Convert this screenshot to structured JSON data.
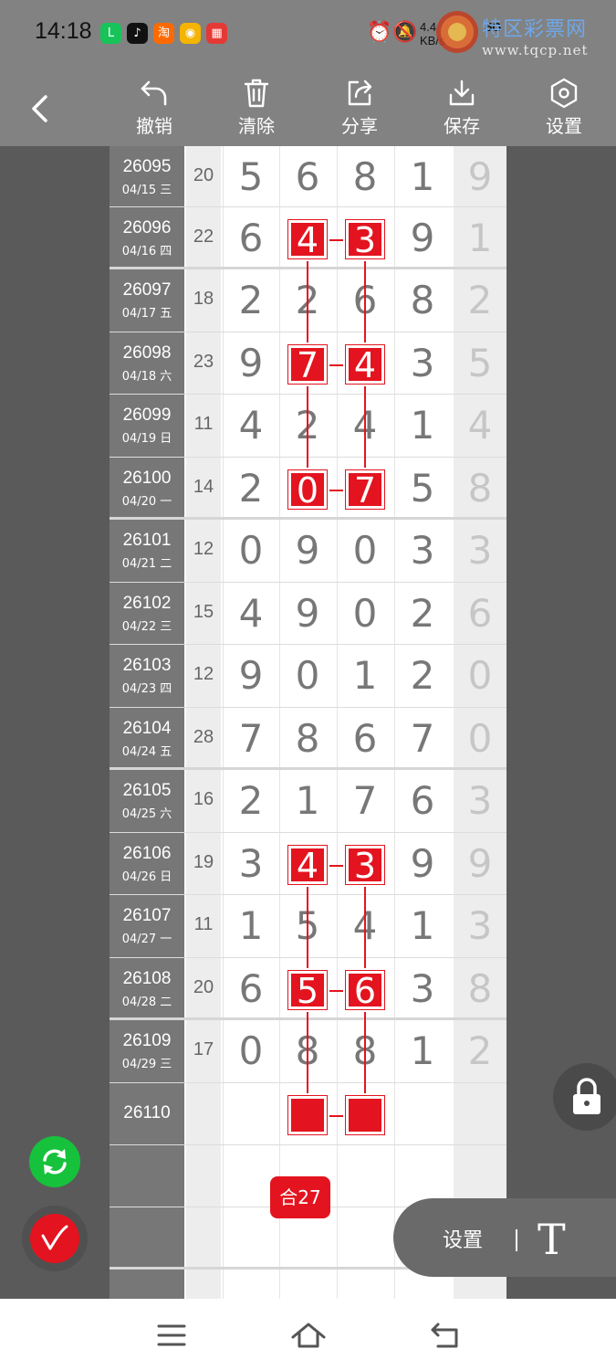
{
  "status_bar": {
    "time": "14:18",
    "apps": [
      {
        "icon": "wechat-icon",
        "glyph": "L",
        "color": "#18c35a"
      },
      {
        "icon": "tiktok-icon",
        "glyph": "♪",
        "color": "#111111"
      },
      {
        "icon": "taobao-icon",
        "glyph": "淘",
        "color": "#ff6a00"
      },
      {
        "icon": "app-yellow-icon",
        "glyph": "◉",
        "color": "#f4b400"
      },
      {
        "icon": "calendar-icon",
        "glyph": "▦",
        "color": "#e53935"
      }
    ],
    "speed": "4.4",
    "speed_unit": "KB/s",
    "network": "5G"
  },
  "watermark": {
    "title": "特区彩票网",
    "url": "www.tqcp.net"
  },
  "toolbar": {
    "undo_label": "撤销",
    "clear_label": "清除",
    "share_label": "分享",
    "save_label": "保存",
    "settings_label": "设置"
  },
  "table": {
    "rows": [
      {
        "id": "26095",
        "date": "04/15 三",
        "sum": "20",
        "digits": [
          "5",
          "6",
          "8",
          "1"
        ],
        "last": "9"
      },
      {
        "id": "26096",
        "date": "04/16 四",
        "sum": "22",
        "digits": [
          "6",
          "4",
          "3",
          "9"
        ],
        "last": "1"
      },
      {
        "id": "26097",
        "date": "04/17 五",
        "sum": "18",
        "digits": [
          "2",
          "2",
          "6",
          "8"
        ],
        "last": "2"
      },
      {
        "id": "26098",
        "date": "04/18 六",
        "sum": "23",
        "digits": [
          "9",
          "7",
          "4",
          "3"
        ],
        "last": "5"
      },
      {
        "id": "26099",
        "date": "04/19 日",
        "sum": "11",
        "digits": [
          "4",
          "2",
          "4",
          "1"
        ],
        "last": "4"
      },
      {
        "id": "26100",
        "date": "04/20 一",
        "sum": "14",
        "digits": [
          "2",
          "0",
          "7",
          "5"
        ],
        "last": "8"
      },
      {
        "id": "26101",
        "date": "04/21 二",
        "sum": "12",
        "digits": [
          "0",
          "9",
          "0",
          "3"
        ],
        "last": "3"
      },
      {
        "id": "26102",
        "date": "04/22 三",
        "sum": "15",
        "digits": [
          "4",
          "9",
          "0",
          "2"
        ],
        "last": "6"
      },
      {
        "id": "26103",
        "date": "04/23 四",
        "sum": "12",
        "digits": [
          "9",
          "0",
          "1",
          "2"
        ],
        "last": "0"
      },
      {
        "id": "26104",
        "date": "04/24 五",
        "sum": "28",
        "digits": [
          "7",
          "8",
          "6",
          "7"
        ],
        "last": "0"
      },
      {
        "id": "26105",
        "date": "04/25 六",
        "sum": "16",
        "digits": [
          "2",
          "1",
          "7",
          "6"
        ],
        "last": "3"
      },
      {
        "id": "26106",
        "date": "04/26 日",
        "sum": "19",
        "digits": [
          "3",
          "4",
          "3",
          "9"
        ],
        "last": "9"
      },
      {
        "id": "26107",
        "date": "04/27 一",
        "sum": "11",
        "digits": [
          "1",
          "5",
          "4",
          "1"
        ],
        "last": "3"
      },
      {
        "id": "26108",
        "date": "04/28 二",
        "sum": "20",
        "digits": [
          "6",
          "5",
          "6",
          "3"
        ],
        "last": "8"
      },
      {
        "id": "26109",
        "date": "04/29 三",
        "sum": "17",
        "digits": [
          "0",
          "8",
          "8",
          "1"
        ],
        "last": "2"
      },
      {
        "id": "26110",
        "date": "",
        "sum": "",
        "digits": [
          "",
          "",
          "",
          ""
        ],
        "last": ""
      },
      {
        "id": "",
        "date": "",
        "sum": "",
        "digits": [
          "",
          "",
          "",
          ""
        ],
        "last": ""
      },
      {
        "id": "",
        "date": "",
        "sum": "",
        "digits": [
          "",
          "",
          "",
          ""
        ],
        "last": ""
      }
    ],
    "marks": [
      {
        "row": 1,
        "col": 1,
        "value": "4"
      },
      {
        "row": 1,
        "col": 2,
        "value": "3"
      },
      {
        "row": 3,
        "col": 1,
        "value": "7"
      },
      {
        "row": 3,
        "col": 2,
        "value": "4"
      },
      {
        "row": 5,
        "col": 1,
        "value": "0"
      },
      {
        "row": 5,
        "col": 2,
        "value": "7"
      },
      {
        "row": 11,
        "col": 1,
        "value": "4"
      },
      {
        "row": 11,
        "col": 2,
        "value": "3"
      },
      {
        "row": 13,
        "col": 1,
        "value": "5"
      },
      {
        "row": 13,
        "col": 2,
        "value": "6"
      },
      {
        "row": 15,
        "col": 1,
        "value": ""
      },
      {
        "row": 15,
        "col": 2,
        "value": ""
      }
    ],
    "mark_color": "#e3141f",
    "sum_badge": "合27"
  },
  "floating": {
    "settings_label": "设置",
    "text_tool_glyph": "T"
  }
}
